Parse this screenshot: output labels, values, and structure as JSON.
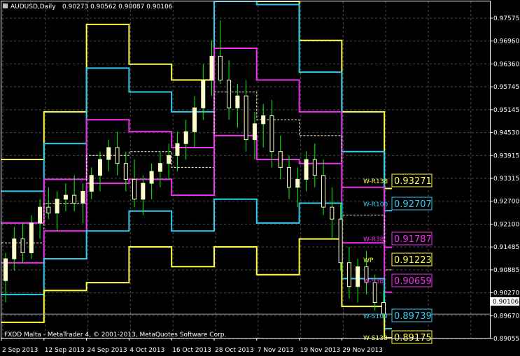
{
  "header": {
    "symbol_info": "AUDUSD,Daily",
    "ohlc": "0.90273 0.90562 0.90087 0.90106"
  },
  "footer": {
    "copyright": "FXDD Malta - MetaTrader 4, © 2001-2013, MetaQuotes Software Corp."
  },
  "colors": {
    "background": "#000000",
    "grid": "#4a4a4a",
    "frame": "#ffffff",
    "candle": "#ffffcc",
    "wick": "#00ff00",
    "pivot_outer": "#ffff44",
    "pivot_r100": "#33ccee",
    "pivot_r38": "#ee33ee",
    "pivot_mid": "#ffffcc"
  },
  "chart_data": {
    "type": "candlestick",
    "price_range": [
      0.8951,
      0.9798
    ],
    "y_ticks": [
      "0.97575",
      "0.96960",
      "0.96360",
      "0.95745",
      "0.95145",
      "0.94530",
      "0.93915",
      "0.93315",
      "0.92700",
      "0.92100",
      "0.91485",
      "0.90885",
      "0.90270",
      "0.89670",
      "0.89055"
    ],
    "x_ticks": [
      "2 Sep 2013",
      "12 Sep 2013",
      "24 Sep 2013",
      "4 Oct 2013",
      "16 Oct 2013",
      "28 Oct 2013",
      "7 Nov 2013",
      "19 Nov 2013",
      "29 Nov 2013"
    ],
    "current_price": "0.90106",
    "candles_ohlc": [
      [
        0.9095,
        0.9165,
        0.904,
        0.915
      ],
      [
        0.915,
        0.923,
        0.912,
        0.92
      ],
      [
        0.92,
        0.924,
        0.914,
        0.9165
      ],
      [
        0.9165,
        0.926,
        0.915,
        0.924
      ],
      [
        0.924,
        0.93,
        0.92,
        0.928
      ],
      [
        0.928,
        0.933,
        0.925,
        0.9265
      ],
      [
        0.9265,
        0.932,
        0.922,
        0.93
      ],
      [
        0.93,
        0.934,
        0.927,
        0.931
      ],
      [
        0.931,
        0.936,
        0.927,
        0.929
      ],
      [
        0.929,
        0.934,
        0.924,
        0.932
      ],
      [
        0.932,
        0.938,
        0.93,
        0.936
      ],
      [
        0.936,
        0.942,
        0.932,
        0.94
      ],
      [
        0.94,
        0.945,
        0.937,
        0.943
      ],
      [
        0.943,
        0.947,
        0.936,
        0.939
      ],
      [
        0.939,
        0.942,
        0.932,
        0.935
      ],
      [
        0.935,
        0.94,
        0.928,
        0.93
      ],
      [
        0.93,
        0.936,
        0.926,
        0.934
      ],
      [
        0.934,
        0.939,
        0.93,
        0.937
      ],
      [
        0.937,
        0.942,
        0.933,
        0.939
      ],
      [
        0.939,
        0.944,
        0.935,
        0.941
      ],
      [
        0.941,
        0.947,
        0.937,
        0.944
      ],
      [
        0.944,
        0.95,
        0.94,
        0.947
      ],
      [
        0.947,
        0.956,
        0.943,
        0.953
      ],
      [
        0.953,
        0.964,
        0.95,
        0.96
      ],
      [
        0.96,
        0.97,
        0.956,
        0.966
      ],
      [
        0.966,
        0.975,
        0.959,
        0.96
      ],
      [
        0.96,
        0.965,
        0.95,
        0.953
      ],
      [
        0.953,
        0.959,
        0.948,
        0.956
      ],
      [
        0.956,
        0.96,
        0.942,
        0.945
      ],
      [
        0.945,
        0.952,
        0.94,
        0.949
      ],
      [
        0.949,
        0.954,
        0.943,
        0.951
      ],
      [
        0.951,
        0.955,
        0.938,
        0.942
      ],
      [
        0.942,
        0.946,
        0.935,
        0.938
      ],
      [
        0.938,
        0.941,
        0.93,
        0.933
      ],
      [
        0.933,
        0.938,
        0.928,
        0.935
      ],
      [
        0.935,
        0.942,
        0.932,
        0.94
      ],
      [
        0.94,
        0.944,
        0.933,
        0.936
      ],
      [
        0.936,
        0.94,
        0.926,
        0.928
      ],
      [
        0.928,
        0.933,
        0.92,
        0.925
      ],
      [
        0.925,
        0.929,
        0.912,
        0.914
      ],
      [
        0.914,
        0.918,
        0.905,
        0.908
      ],
      [
        0.908,
        0.915,
        0.904,
        0.913
      ],
      [
        0.913,
        0.917,
        0.906,
        0.909
      ],
      [
        0.909,
        0.911,
        0.902,
        0.904
      ],
      [
        0.904,
        0.907,
        0.9,
        0.9011
      ]
    ],
    "levels": [
      {
        "label": "W-R138",
        "value": "0.93271",
        "color": "#ffff44"
      },
      {
        "label": "W-R100",
        "value": "0.92707",
        "color": "#33ccee"
      },
      {
        "label": "W-R38",
        "value": "0.91787",
        "color": "#ee33ee"
      },
      {
        "label": "WP",
        "value": "0.91223",
        "color": "#ffff44"
      },
      {
        "label": "W-S38",
        "value": "0.90659",
        "color": "#ee33ee"
      },
      {
        "label": "W-S100",
        "value": "0.89739",
        "color": "#33ccee"
      },
      {
        "label": "W-S138",
        "value": "0.89175",
        "color": "#ffff44"
      }
    ],
    "pivot_weeks": [
      {
        "r138": 0.94,
        "r100": 0.932,
        "r38": 0.924,
        "p": 0.919,
        "s38": 0.914,
        "s100": 0.906,
        "s138": 0.899
      },
      {
        "r138": 0.952,
        "r100": 0.944,
        "r38": 0.935,
        "p": 0.929,
        "s38": 0.922,
        "s100": 0.915,
        "s138": 0.907
      },
      {
        "r138": 0.974,
        "r100": 0.963,
        "r38": 0.95,
        "p": 0.941,
        "s38": 0.934,
        "s100": 0.922,
        "s138": 0.909
      },
      {
        "r138": 0.964,
        "r100": 0.957,
        "r38": 0.947,
        "p": 0.942,
        "s38": 0.935,
        "s100": 0.927,
        "s138": 0.918
      },
      {
        "r138": 0.96,
        "r100": 0.952,
        "r38": 0.943,
        "p": 0.938,
        "s38": 0.931,
        "s100": 0.922,
        "s138": 0.913
      },
      {
        "r138": 0.996,
        "r100": 0.984,
        "r38": 0.968,
        "p": 0.957,
        "s38": 0.946,
        "s100": 0.93,
        "s138": 0.918
      },
      {
        "r138": 0.99,
        "r100": 0.979,
        "r38": 0.96,
        "p": 0.95,
        "s38": 0.94,
        "s100": 0.924,
        "s138": 0.911
      },
      {
        "r138": 0.97,
        "r100": 0.962,
        "r38": 0.952,
        "p": 0.946,
        "s38": 0.939,
        "s100": 0.929,
        "s138": 0.92
      },
      {
        "r138": 0.952,
        "r100": 0.942,
        "r38": 0.933,
        "p": 0.926,
        "s38": 0.919,
        "s100": 0.91,
        "s138": 0.903
      },
      {
        "r138": 0.9327,
        "r100": 0.9271,
        "r38": 0.9179,
        "p": 0.9122,
        "s38": 0.9066,
        "s100": 0.8974,
        "s138": 0.8918
      }
    ]
  }
}
